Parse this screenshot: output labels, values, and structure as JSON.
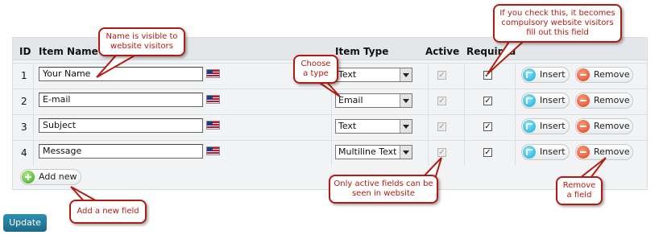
{
  "table": {
    "headers": {
      "id": "ID",
      "item_name": "Item Name",
      "item_type": "Item Type",
      "active": "Active",
      "required": "Required"
    },
    "rows": [
      {
        "id": "1",
        "name": "Your Name",
        "type": "Text",
        "active": true,
        "required": true
      },
      {
        "id": "2",
        "name": "E-mail",
        "type": "Email",
        "active": true,
        "required": true
      },
      {
        "id": "3",
        "name": "Subject",
        "type": "Text",
        "active": true,
        "required": true
      },
      {
        "id": "4",
        "name": "Message",
        "type": "Multiline Text",
        "active": true,
        "required": true
      }
    ],
    "insert_label": "Insert",
    "remove_label": "Remove",
    "add_new_label": "Add new"
  },
  "update_label": "Update",
  "callouts": {
    "name_visible": "Name is visible to website visitors",
    "choose_type": "Choose a type",
    "required_info": "If you check this, it becomes compulsory website visitors fill out this field",
    "active_info": "Only active fields can be seen in website",
    "remove_info": "Remove a field",
    "add_info": "Add a new field"
  },
  "colors": {
    "callout_border": "#b11c12",
    "update_button": "#1a6b88",
    "panel_background": "#f1f3f4"
  },
  "icons": [
    "us-flag-icon",
    "insert-icon",
    "remove-icon",
    "add-icon",
    "select-arrow-icon"
  ]
}
